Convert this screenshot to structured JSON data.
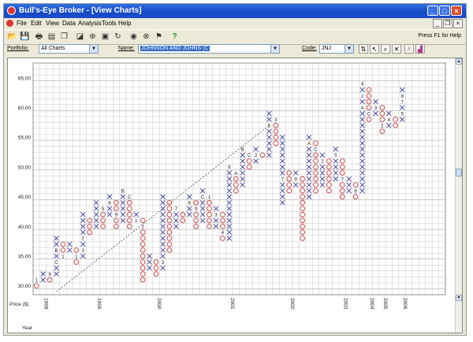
{
  "window": {
    "title": "Bull's-Eye Broker - [View Charts]",
    "controls": {
      "minimize": "_",
      "maximize": "□",
      "close": "×"
    }
  },
  "menu": {
    "items": [
      "File",
      "Edit",
      "View",
      "Data",
      "Analysis",
      "Tools",
      "Help"
    ],
    "mdi_controls": {
      "minimize": "_",
      "restore": "❐",
      "close": "×"
    }
  },
  "toolbar": {
    "help_hint": "Press F1 for Help",
    "tool_icons": [
      "open-icon",
      "save-icon",
      "print-icon",
      "preview-icon",
      "copy-icon",
      "chart-icon",
      "zoom-icon",
      "window-icon",
      "refresh-icon",
      "eye-icon",
      "stop-icon",
      "flag-icon",
      "help-icon"
    ]
  },
  "params": {
    "portfolio_label": "Portfolio:",
    "portfolio_value": "All Charts",
    "name_label": "Name:",
    "name_value": "JOHNSON AND JOHNS (C",
    "code_label": "Code:",
    "code_value": "JNJ"
  },
  "chart_data": {
    "type": "point-and-figure",
    "ylabel": "Price ($)",
    "xlabel": "Year",
    "y_ticks": [
      "65,00",
      "60,00",
      "55,00",
      "50,00",
      "45,00",
      "40,00",
      "35,00",
      "30,00"
    ],
    "y_values": [
      65,
      60,
      55,
      50,
      45,
      40,
      35,
      30
    ],
    "ylim": [
      28.5,
      67.5
    ],
    "box_size": 1,
    "year_labels": [
      {
        "col": 1,
        "label": "1998"
      },
      {
        "col": 9,
        "label": "1999"
      },
      {
        "col": 18,
        "label": "2000"
      },
      {
        "col": 29,
        "label": "2001"
      },
      {
        "col": 38,
        "label": "2002"
      },
      {
        "col": 46,
        "label": "2003"
      },
      {
        "col": 50,
        "label": "2004"
      },
      {
        "col": 52,
        "label": "2005"
      },
      {
        "col": 55,
        "label": "2006"
      }
    ],
    "columns": [
      {
        "t": "O",
        "from": 30,
        "to": 31
      },
      {
        "t": "X",
        "from": 31,
        "to": 32
      },
      {
        "t": "O",
        "from": 31,
        "to": 32
      },
      {
        "t": "X",
        "from": 32,
        "to": 38
      },
      {
        "t": "O",
        "from": 35,
        "to": 37
      },
      {
        "t": "X",
        "from": 36,
        "to": 37
      },
      {
        "t": "O",
        "from": 34,
        "to": 36
      },
      {
        "t": "X",
        "from": 35,
        "to": 42
      },
      {
        "t": "O",
        "from": 39,
        "to": 41
      },
      {
        "t": "X",
        "from": 40,
        "to": 44
      },
      {
        "t": "O",
        "from": 40,
        "to": 43
      },
      {
        "t": "X",
        "from": 42,
        "to": 45
      },
      {
        "t": "O",
        "from": 40,
        "to": 44
      },
      {
        "t": "X",
        "from": 41,
        "to": 46
      },
      {
        "t": "O",
        "from": 40,
        "to": 45
      },
      {
        "t": "X",
        "from": 41,
        "to": 42
      },
      {
        "t": "O",
        "from": 31,
        "to": 41
      },
      {
        "t": "X",
        "from": 33,
        "to": 35
      },
      {
        "t": "O",
        "from": 32,
        "to": 34
      },
      {
        "t": "X",
        "from": 33,
        "to": 45
      },
      {
        "t": "O",
        "from": 36,
        "to": 44
      },
      {
        "t": "X",
        "from": 40,
        "to": 43
      },
      {
        "t": "O",
        "from": 41,
        "to": 42
      },
      {
        "t": "X",
        "from": 42,
        "to": 45
      },
      {
        "t": "O",
        "from": 40,
        "to": 44
      },
      {
        "t": "X",
        "from": 41,
        "to": 46
      },
      {
        "t": "O",
        "from": 40,
        "to": 45
      },
      {
        "t": "X",
        "from": 40,
        "to": 43
      },
      {
        "t": "O",
        "from": 38,
        "to": 42
      },
      {
        "t": "X",
        "from": 38,
        "to": 50
      },
      {
        "t": "O",
        "from": 46,
        "to": 49
      },
      {
        "t": "X",
        "from": 47,
        "to": 53
      },
      {
        "t": "O",
        "from": 50,
        "to": 52
      },
      {
        "t": "X",
        "from": 51,
        "to": 53
      },
      {
        "t": "O",
        "from": 52,
        "to": 52
      },
      {
        "t": "X",
        "from": 52,
        "to": 59
      },
      {
        "t": "O",
        "from": 54,
        "to": 58
      },
      {
        "t": "X",
        "from": 44,
        "to": 55
      },
      {
        "t": "O",
        "from": 46,
        "to": 49
      },
      {
        "t": "X",
        "from": 47,
        "to": 49
      },
      {
        "t": "O",
        "from": 38,
        "to": 48
      },
      {
        "t": "X",
        "from": 45,
        "to": 55
      },
      {
        "t": "O",
        "from": 46,
        "to": 54
      },
      {
        "t": "X",
        "from": 47,
        "to": 52
      },
      {
        "t": "O",
        "from": 46,
        "to": 51
      },
      {
        "t": "X",
        "from": 48,
        "to": 53
      },
      {
        "t": "O",
        "from": 45,
        "to": 51
      },
      {
        "t": "X",
        "from": 46,
        "to": 48
      },
      {
        "t": "O",
        "from": 45,
        "to": 47
      },
      {
        "t": "X",
        "from": 46,
        "to": 64
      },
      {
        "t": "O",
        "from": 58,
        "to": 63
      },
      {
        "t": "X",
        "from": 59,
        "to": 61
      },
      {
        "t": "O",
        "from": 56,
        "to": 60
      },
      {
        "t": "X",
        "from": 57,
        "to": 59
      },
      {
        "t": "O",
        "from": 57,
        "to": 58
      },
      {
        "t": "X",
        "from": 58,
        "to": 63
      }
    ],
    "month_labels": [
      {
        "col": 0,
        "price": 31,
        "label": "1"
      },
      {
        "col": 2,
        "price": 32,
        "label": "9"
      },
      {
        "col": 3,
        "price": 36,
        "label": "B"
      },
      {
        "col": 3,
        "price": 34,
        "label": "C"
      },
      {
        "col": 4,
        "price": 35,
        "label": "1"
      },
      {
        "col": 6,
        "price": 35,
        "label": "1"
      },
      {
        "col": 7,
        "price": 38,
        "label": "2"
      },
      {
        "col": 7,
        "price": 36,
        "label": "3"
      },
      {
        "col": 8,
        "price": 44,
        "label": "4"
      },
      {
        "col": 10,
        "price": 43,
        "label": "5"
      },
      {
        "col": 11,
        "price": 44,
        "label": "8"
      },
      {
        "col": 12,
        "price": 42,
        "label": "9"
      },
      {
        "col": 13,
        "price": 46,
        "label": "B"
      },
      {
        "col": 14,
        "price": 45,
        "label": "C"
      },
      {
        "col": 15,
        "price": 41,
        "label": "1"
      },
      {
        "col": 16,
        "price": 40,
        "label": "2"
      },
      {
        "col": 19,
        "price": 34,
        "label": "3"
      },
      {
        "col": 20,
        "price": 33,
        "label": "4"
      },
      {
        "col": 21,
        "price": 43,
        "label": "7"
      },
      {
        "col": 23,
        "price": 44,
        "label": "8"
      },
      {
        "col": 24,
        "price": 43,
        "label": "9"
      },
      {
        "col": 25,
        "price": 45,
        "label": "C"
      },
      {
        "col": 26,
        "price": 45,
        "label": "1"
      },
      {
        "col": 27,
        "price": 42,
        "label": "3"
      },
      {
        "col": 28,
        "price": 39,
        "label": "4"
      },
      {
        "col": 29,
        "price": 50,
        "label": "8"
      },
      {
        "col": 30,
        "price": 49,
        "label": "A"
      },
      {
        "col": 31,
        "price": 53,
        "label": "B"
      },
      {
        "col": 32,
        "price": 52,
        "label": "C"
      },
      {
        "col": 33,
        "price": 52,
        "label": "2"
      },
      {
        "col": 35,
        "price": 57,
        "label": "5"
      },
      {
        "col": 36,
        "price": 58,
        "label": "3"
      },
      {
        "col": 37,
        "price": 48,
        "label": "7"
      },
      {
        "col": 39,
        "price": 48,
        "label": "9"
      },
      {
        "col": 41,
        "price": 54,
        "label": "A"
      },
      {
        "col": 42,
        "price": 53,
        "label": "C"
      },
      {
        "col": 43,
        "price": 51,
        "label": "2"
      },
      {
        "col": 45,
        "price": 52,
        "label": "5"
      },
      {
        "col": 46,
        "price": 48,
        "label": "7"
      },
      {
        "col": 48,
        "price": 46,
        "label": "8"
      },
      {
        "col": 49,
        "price": 64,
        "label": "4"
      },
      {
        "col": 49,
        "price": 62,
        "label": "2"
      },
      {
        "col": 49,
        "price": 60,
        "label": "A"
      },
      {
        "col": 50,
        "price": 59,
        "label": "C"
      },
      {
        "col": 51,
        "price": 60,
        "label": "3"
      },
      {
        "col": 52,
        "price": 57,
        "label": "2"
      },
      {
        "col": 53,
        "price": 58,
        "label": "4"
      },
      {
        "col": 55,
        "price": 62,
        "label": "8"
      },
      {
        "col": 55,
        "price": 61,
        "label": "7"
      },
      {
        "col": 55,
        "price": 59,
        "label": "5"
      }
    ],
    "trendline": {
      "from": {
        "col": 3,
        "price": 29
      },
      "to": {
        "col": 35,
        "price": 57
      }
    },
    "colors": {
      "x": "#3a3a9a",
      "o": "#c84040",
      "grid": "#c8c8c8",
      "trend": "#555555"
    }
  }
}
